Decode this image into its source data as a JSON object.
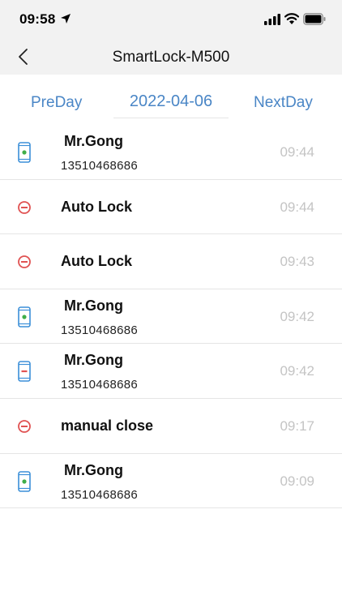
{
  "status_bar": {
    "time": "09:58"
  },
  "nav": {
    "title": "SmartLock-M500"
  },
  "date_bar": {
    "prev_label": "PreDay",
    "current_date": "2022-04-06",
    "next_label": "NextDay"
  },
  "records": [
    {
      "type": "phone",
      "icon": "phone-unlock-icon",
      "name": "Mr.Gong",
      "phone": "13510468686",
      "time": "09:44"
    },
    {
      "type": "lock",
      "icon": "lock-icon",
      "title": "Auto Lock",
      "time": "09:44"
    },
    {
      "type": "lock",
      "icon": "lock-icon",
      "title": "Auto Lock",
      "time": "09:43"
    },
    {
      "type": "phone",
      "icon": "phone-unlock-icon",
      "name": "Mr.Gong",
      "phone": "13510468686",
      "time": "09:42"
    },
    {
      "type": "phone",
      "icon": "phone-lock-icon",
      "name": "Mr.Gong",
      "phone": "13510468686",
      "time": "09:42"
    },
    {
      "type": "lock",
      "icon": "lock-icon",
      "title": "manual close",
      "time": "09:17"
    },
    {
      "type": "phone",
      "icon": "phone-unlock-icon",
      "name": "Mr.Gong",
      "phone": "13510468686",
      "time": "09:09"
    }
  ],
  "colors": {
    "accent": "#4a86c6",
    "phone_blue": "#3b8fd8",
    "unlock_green": "#3fae49",
    "lock_red": "#e05252",
    "time_gray": "#c4c4c4"
  }
}
